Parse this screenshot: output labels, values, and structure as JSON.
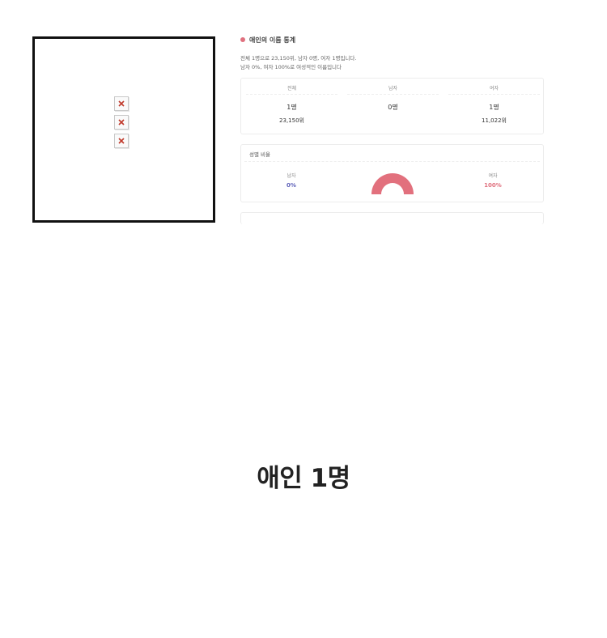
{
  "image_panel": {
    "broken_image_count": 3
  },
  "stats": {
    "title": "애인의 이름 통계",
    "summary_line1": "전체 1명으로 23,150위, 남자 0명, 여자 1명입니다.",
    "summary_line2": "남자 0%, 여자 100%로 여성적인 이름입니다",
    "table": {
      "columns": [
        {
          "header": "전체",
          "count": "1명",
          "rank": "23,150위"
        },
        {
          "header": "남자",
          "count": "0명",
          "rank": ""
        },
        {
          "header": "여자",
          "count": "1명",
          "rank": "11,022위"
        }
      ]
    },
    "ratio": {
      "title": "성별 비율",
      "male_label": "남자",
      "male_pct": "0%",
      "female_label": "여자",
      "female_pct": "100%",
      "female_fraction": 1.0,
      "colors": {
        "male": "#5c5fb8",
        "female": "#e0717f",
        "chart": "#e2707d"
      }
    }
  },
  "caption": "애인 1명"
}
